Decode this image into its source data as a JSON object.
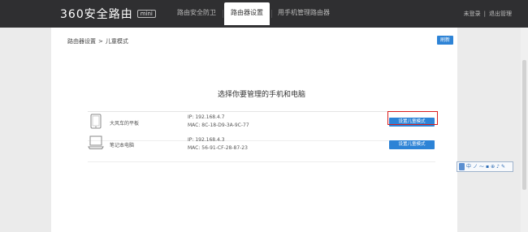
{
  "header": {
    "logo_text": "360安全路由",
    "logo_badge": "mini",
    "tabs": [
      {
        "label": "路由安全防卫",
        "active": false
      },
      {
        "label": "路由器设置",
        "active": true
      },
      {
        "label": "用手机管理路由器",
        "active": false
      }
    ],
    "user": {
      "name": "未登录",
      "separator": "|",
      "logout": "退出管理"
    }
  },
  "breadcrumb": {
    "parent": "路由器设置",
    "separator": ">",
    "current": "儿童模式"
  },
  "refresh_label": "刷新",
  "section_title": "选择你要管理的手机和电脑",
  "devices": [
    {
      "icon": "tablet-icon",
      "name": "大风车的平板",
      "ip": "IP: 192.168.4.7",
      "mac": "MAC: 8C-18-D9-3A-9C-77",
      "button_label": "设置儿童模式",
      "highlighted": true
    },
    {
      "icon": "laptop-icon",
      "name": "笔记本电脑",
      "ip": "IP: 192.168.4.3",
      "mac": "MAC: 56-91-CF-28-87-23",
      "button_label": "设置儿童模式",
      "highlighted": false
    }
  ],
  "ime_toolbar": {
    "items": [
      "中",
      "ノ",
      "⁓",
      "▪",
      "⊕",
      "♪",
      "✎"
    ]
  },
  "colors": {
    "header_bg": "#2f2f31",
    "accent_blue": "#2d83d6",
    "highlight_red": "#d91e1e",
    "page_bg": "#ebebeb"
  }
}
